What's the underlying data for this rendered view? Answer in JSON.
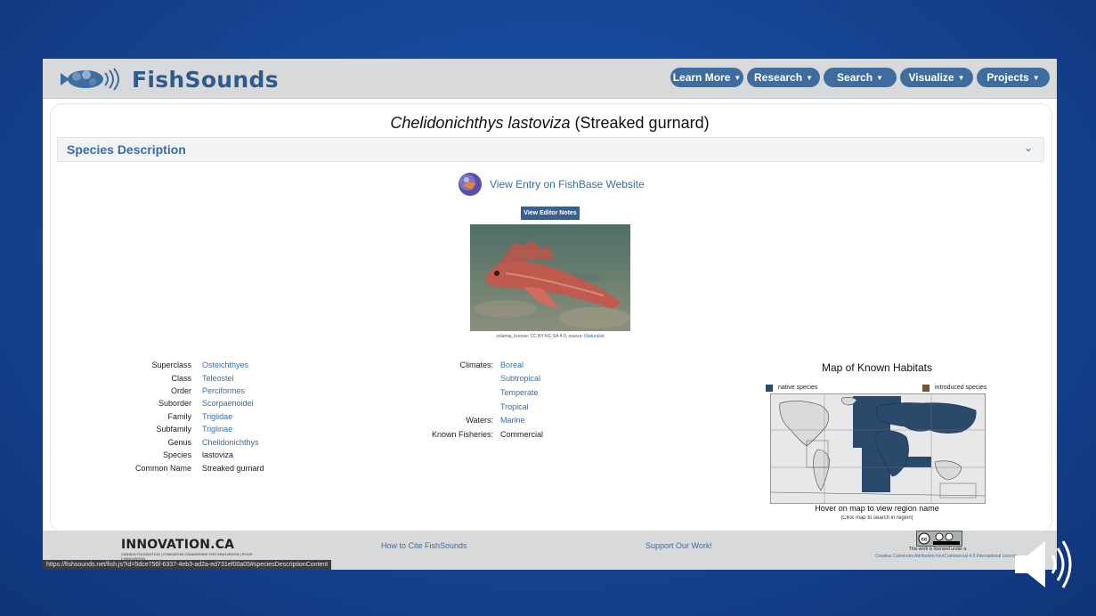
{
  "header": {
    "brand": "FishSounds",
    "nav": [
      {
        "label": "Learn More"
      },
      {
        "label": "Research"
      },
      {
        "label": "Search"
      },
      {
        "label": "Visualize"
      },
      {
        "label": "Projects"
      }
    ]
  },
  "title": {
    "scientific": "Chelidonichthys lastoviza",
    "common": "(Streaked gurnard)"
  },
  "section": {
    "title": "Species Description"
  },
  "fishbase_link": "View Entry on FishBase Website",
  "editor_notes_button": "View Editor Notes",
  "photo": {
    "caption_prefix": "zslamaj, license: CC BY-NC-SA 4.0, source: ",
    "caption_source": "iNaturalist"
  },
  "taxonomy": [
    {
      "label": "Superclass",
      "value": "Osteichthyes",
      "link": true
    },
    {
      "label": "Class",
      "value": "Teleostei",
      "link": true
    },
    {
      "label": "Order",
      "value": "Perciformes",
      "link": true
    },
    {
      "label": "Suborder",
      "value": "Scorpaenoidei",
      "link": true
    },
    {
      "label": "Family",
      "value": "Triglidae",
      "link": true
    },
    {
      "label": "Subfamily",
      "value": "Triglinae",
      "link": true
    },
    {
      "label": "Genus",
      "value": "Chelidonichthys",
      "link": true
    },
    {
      "label": "Species",
      "value": "lastoviza",
      "link": false
    },
    {
      "label": "Common Name",
      "value": "Streaked gurnard",
      "link": false
    }
  ],
  "habitat": {
    "climates_label": "Climates:",
    "climates": [
      "Boreal",
      "Subtropical",
      "Temperate",
      "Tropical"
    ],
    "waters_label": "Waters:",
    "waters": "Marine",
    "fisheries_label": "Known Fisheries:",
    "fisheries": "Commercial"
  },
  "map": {
    "title": "Map of Known Habitats",
    "legend_native": "native species",
    "legend_introduced": "introduced species",
    "hint": "Hover on map to view region name",
    "hint_small": "(Click map to search in region)",
    "colors": {
      "native": "#2b4a6b",
      "introduced": "#7a5230"
    }
  },
  "footer": {
    "innovation_logo": "INNOVATION.CA",
    "innovation_sub": "CANADA FOUNDATION | FONDATION CANADIENNE FOR INNOVATION | POUR L'INNOVATION",
    "cite": "How to Cite FishSounds",
    "support": "Support Our Work!",
    "license_line": "This work is licensed under a",
    "license_link": "Creative Commons Attribution-NonCommercial 4.0 International License"
  },
  "status_url": "https://fishsounds.net/fish.js?id=5dce756f-6337-4eb3-ad2a-ed731ef00a05#speciesDescriptionContent",
  "colors": {
    "accent": "#3a6da3",
    "nav_button": "#3f6c9e",
    "slide_bg": "#1a4fa0"
  }
}
